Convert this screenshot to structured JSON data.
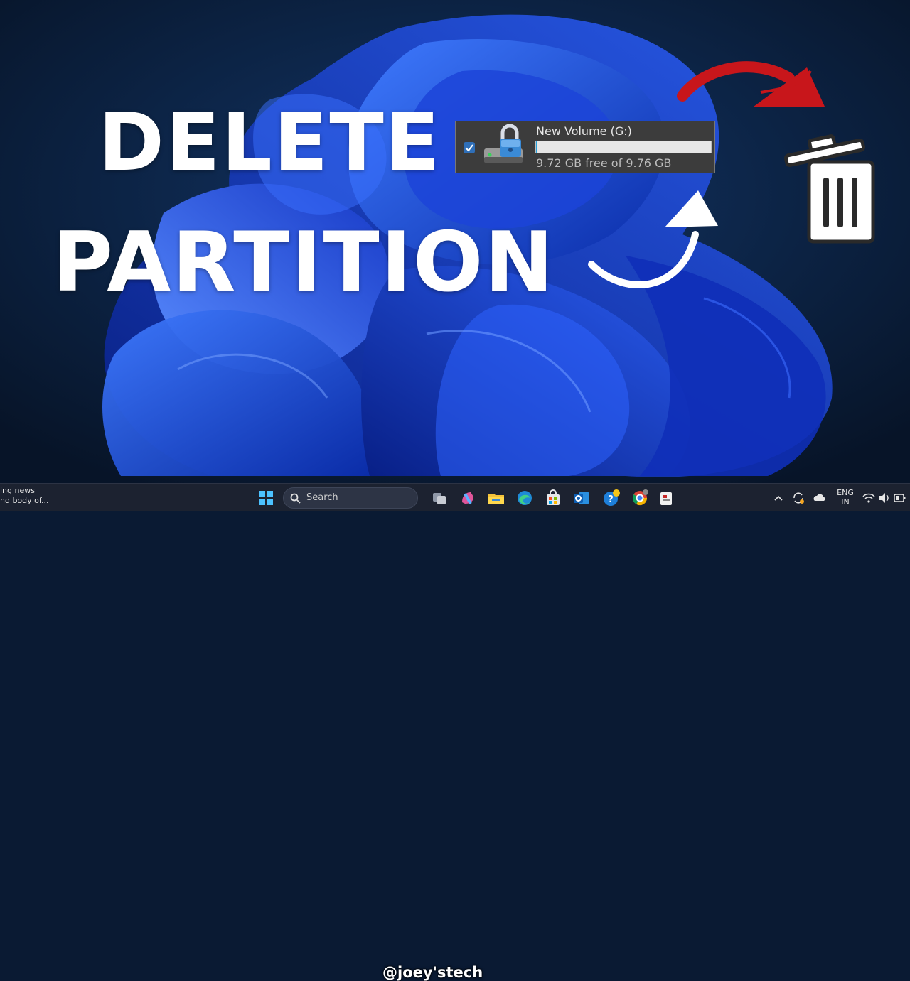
{
  "thumbnail": {
    "headline_line1": "DELETE",
    "headline_line2": "PARTITION",
    "watermark": "@joey'stech"
  },
  "drive": {
    "name": "New Volume (G:)",
    "free_text": "9.72 GB free of 9.76 GB",
    "used_fraction": 0.004,
    "selected": true,
    "icon": "locked-drive-icon"
  },
  "overlay_icons": [
    "curved-red-arrow-icon",
    "curved-white-arrow-icon",
    "trash-can-icon"
  ],
  "taskbar": {
    "news_line1": "ing news",
    "news_line2": "nd body of...",
    "search_label": "Search",
    "language_line1": "ENG",
    "language_line2": "IN",
    "apps": [
      "start-icon",
      "search-icon",
      "task-view-icon",
      "copilot-icon",
      "file-explorer-icon",
      "edge-icon",
      "store-icon",
      "outlook-icon",
      "help-icon",
      "chrome-icon",
      "app-icon"
    ],
    "tray": [
      "chevron-up-icon",
      "sync-icon",
      "onedrive-icon",
      "wifi-icon",
      "volume-icon",
      "battery-icon"
    ]
  },
  "colors": {
    "accent_red": "#c8161b",
    "accent_blue": "#26a0da",
    "wallpaper_bg": "#0a1a33",
    "bloom_blue": "#1b4fe0"
  }
}
